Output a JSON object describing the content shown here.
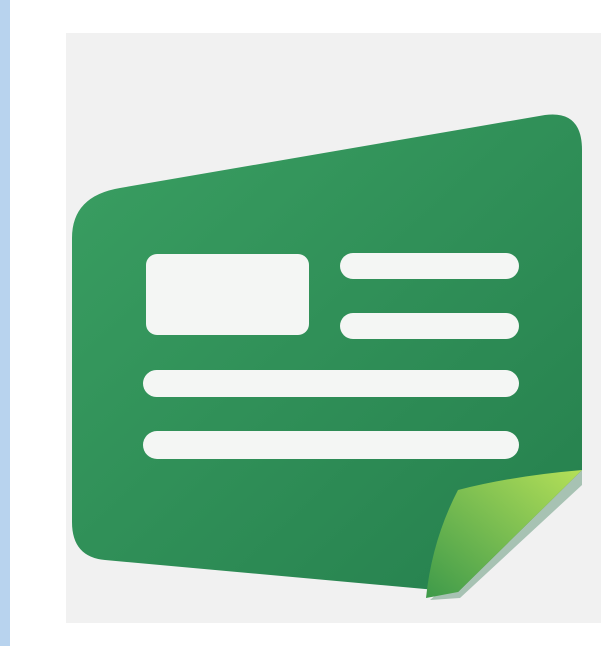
{
  "icon": {
    "name": "news-article-icon",
    "colors": {
      "background_strip": "#b8d3ee",
      "tile": "#f1f1f1",
      "sheet_dark": "#2c8a54",
      "sheet_light": "#3a9f62",
      "fold_light": "#a9dc52",
      "fold_dark": "#3e9a4a",
      "content_lines": "#f4f6f4"
    },
    "content_blocks": [
      "image-placeholder",
      "text-line-short",
      "text-line-short",
      "text-line-long",
      "text-line-long"
    ]
  }
}
